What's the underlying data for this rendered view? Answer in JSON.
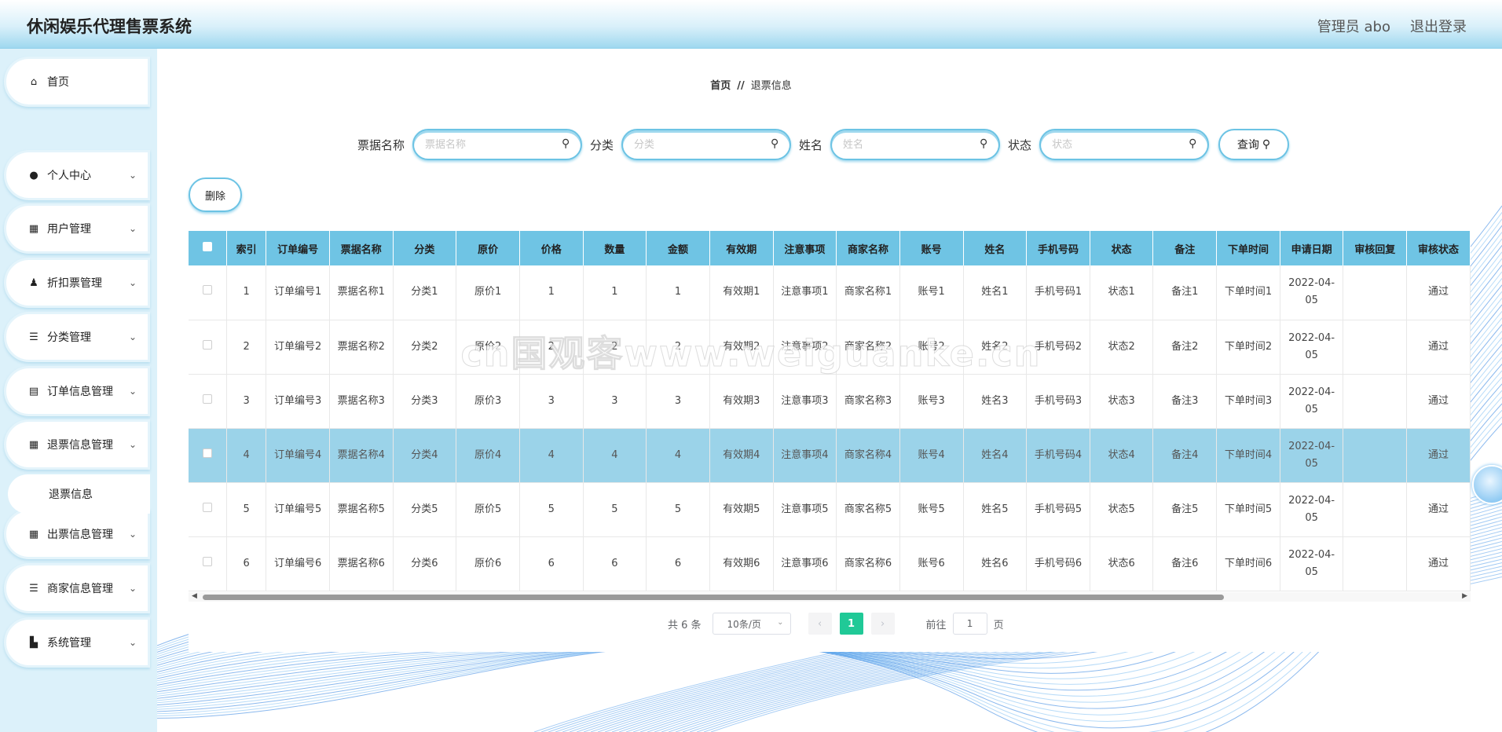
{
  "header": {
    "title": "休闲娱乐代理售票系统",
    "admin": "管理员 abo",
    "logout": "退出登录"
  },
  "sidebar": {
    "items": [
      {
        "label": "首页",
        "icon": "home-icon",
        "glyph": "⌂"
      },
      {
        "label": "个人中心",
        "icon": "user-icon",
        "glyph": "●"
      },
      {
        "label": "用户管理",
        "icon": "grid-icon",
        "glyph": "▦"
      },
      {
        "label": "折扣票管理",
        "icon": "person-icon",
        "glyph": "♟"
      },
      {
        "label": "分类管理",
        "icon": "sliders-icon",
        "glyph": "☰"
      },
      {
        "label": "订单信息管理",
        "icon": "chart-icon",
        "glyph": "▤"
      },
      {
        "label": "退票信息管理",
        "icon": "grid-icon",
        "glyph": "▦"
      },
      {
        "label": "出票信息管理",
        "icon": "grid-icon",
        "glyph": "▦"
      },
      {
        "label": "商家信息管理",
        "icon": "list-icon",
        "glyph": "☰"
      },
      {
        "label": "系统管理",
        "icon": "settings-icon",
        "glyph": "▙"
      }
    ],
    "submenu": {
      "label": "退票信息"
    },
    "arrow": "⌄"
  },
  "breadcrumb": {
    "home": "首页",
    "sep": "//",
    "current": "退票信息"
  },
  "search": {
    "fields": [
      {
        "label": "票据名称",
        "placeholder": "票据名称"
      },
      {
        "label": "分类",
        "placeholder": "分类"
      },
      {
        "label": "姓名",
        "placeholder": "姓名"
      },
      {
        "label": "状态",
        "placeholder": "状态"
      }
    ],
    "button": "查询"
  },
  "actions": {
    "delete": "删除"
  },
  "table": {
    "columns": [
      "索引",
      "订单编号",
      "票据名称",
      "分类",
      "原价",
      "价格",
      "数量",
      "金额",
      "有效期",
      "注意事项",
      "商家名称",
      "账号",
      "姓名",
      "手机号码",
      "状态",
      "备注",
      "下单时间",
      "申请日期",
      "审核回复",
      "审核状态"
    ],
    "rows": [
      [
        "1",
        "订单编号1",
        "票据名称1",
        "分类1",
        "原价1",
        "1",
        "1",
        "1",
        "有效期1",
        "注意事项1",
        "商家名称1",
        "账号1",
        "姓名1",
        "手机号码1",
        "状态1",
        "备注1",
        "下单时间1",
        "2022-04-05",
        "",
        "通过"
      ],
      [
        "2",
        "订单编号2",
        "票据名称2",
        "分类2",
        "原价2",
        "2",
        "2",
        "2",
        "有效期2",
        "注意事项2",
        "商家名称2",
        "账号2",
        "姓名2",
        "手机号码2",
        "状态2",
        "备注2",
        "下单时间2",
        "2022-04-05",
        "",
        "通过"
      ],
      [
        "3",
        "订单编号3",
        "票据名称3",
        "分类3",
        "原价3",
        "3",
        "3",
        "3",
        "有效期3",
        "注意事项3",
        "商家名称3",
        "账号3",
        "姓名3",
        "手机号码3",
        "状态3",
        "备注3",
        "下单时间3",
        "2022-04-05",
        "",
        "通过"
      ],
      [
        "4",
        "订单编号4",
        "票据名称4",
        "分类4",
        "原价4",
        "4",
        "4",
        "4",
        "有效期4",
        "注意事项4",
        "商家名称4",
        "账号4",
        "姓名4",
        "手机号码4",
        "状态4",
        "备注4",
        "下单时间4",
        "2022-04-05",
        "",
        "通过"
      ],
      [
        "5",
        "订单编号5",
        "票据名称5",
        "分类5",
        "原价5",
        "5",
        "5",
        "5",
        "有效期5",
        "注意事项5",
        "商家名称5",
        "账号5",
        "姓名5",
        "手机号码5",
        "状态5",
        "备注5",
        "下单时间5",
        "2022-04-05",
        "",
        "通过"
      ],
      [
        "6",
        "订单编号6",
        "票据名称6",
        "分类6",
        "原价6",
        "6",
        "6",
        "6",
        "有效期6",
        "注意事项6",
        "商家名称6",
        "账号6",
        "姓名6",
        "手机号码6",
        "状态6",
        "备注6",
        "下单时间6",
        "2022-04-05",
        "",
        "通过"
      ]
    ],
    "highlighted_row": 3
  },
  "pagination": {
    "total": "共 6 条",
    "page_size": "10条/页",
    "prev": "‹",
    "current": "1",
    "next": "›",
    "goto_label": "前往",
    "goto_value": "1",
    "page_unit": "页"
  },
  "watermark": "cn国观客www.weiguanke.cn",
  "colors": {
    "accent": "#6fc4e4",
    "highlight": "#9bd3e9",
    "pager_active": "#20c997"
  }
}
